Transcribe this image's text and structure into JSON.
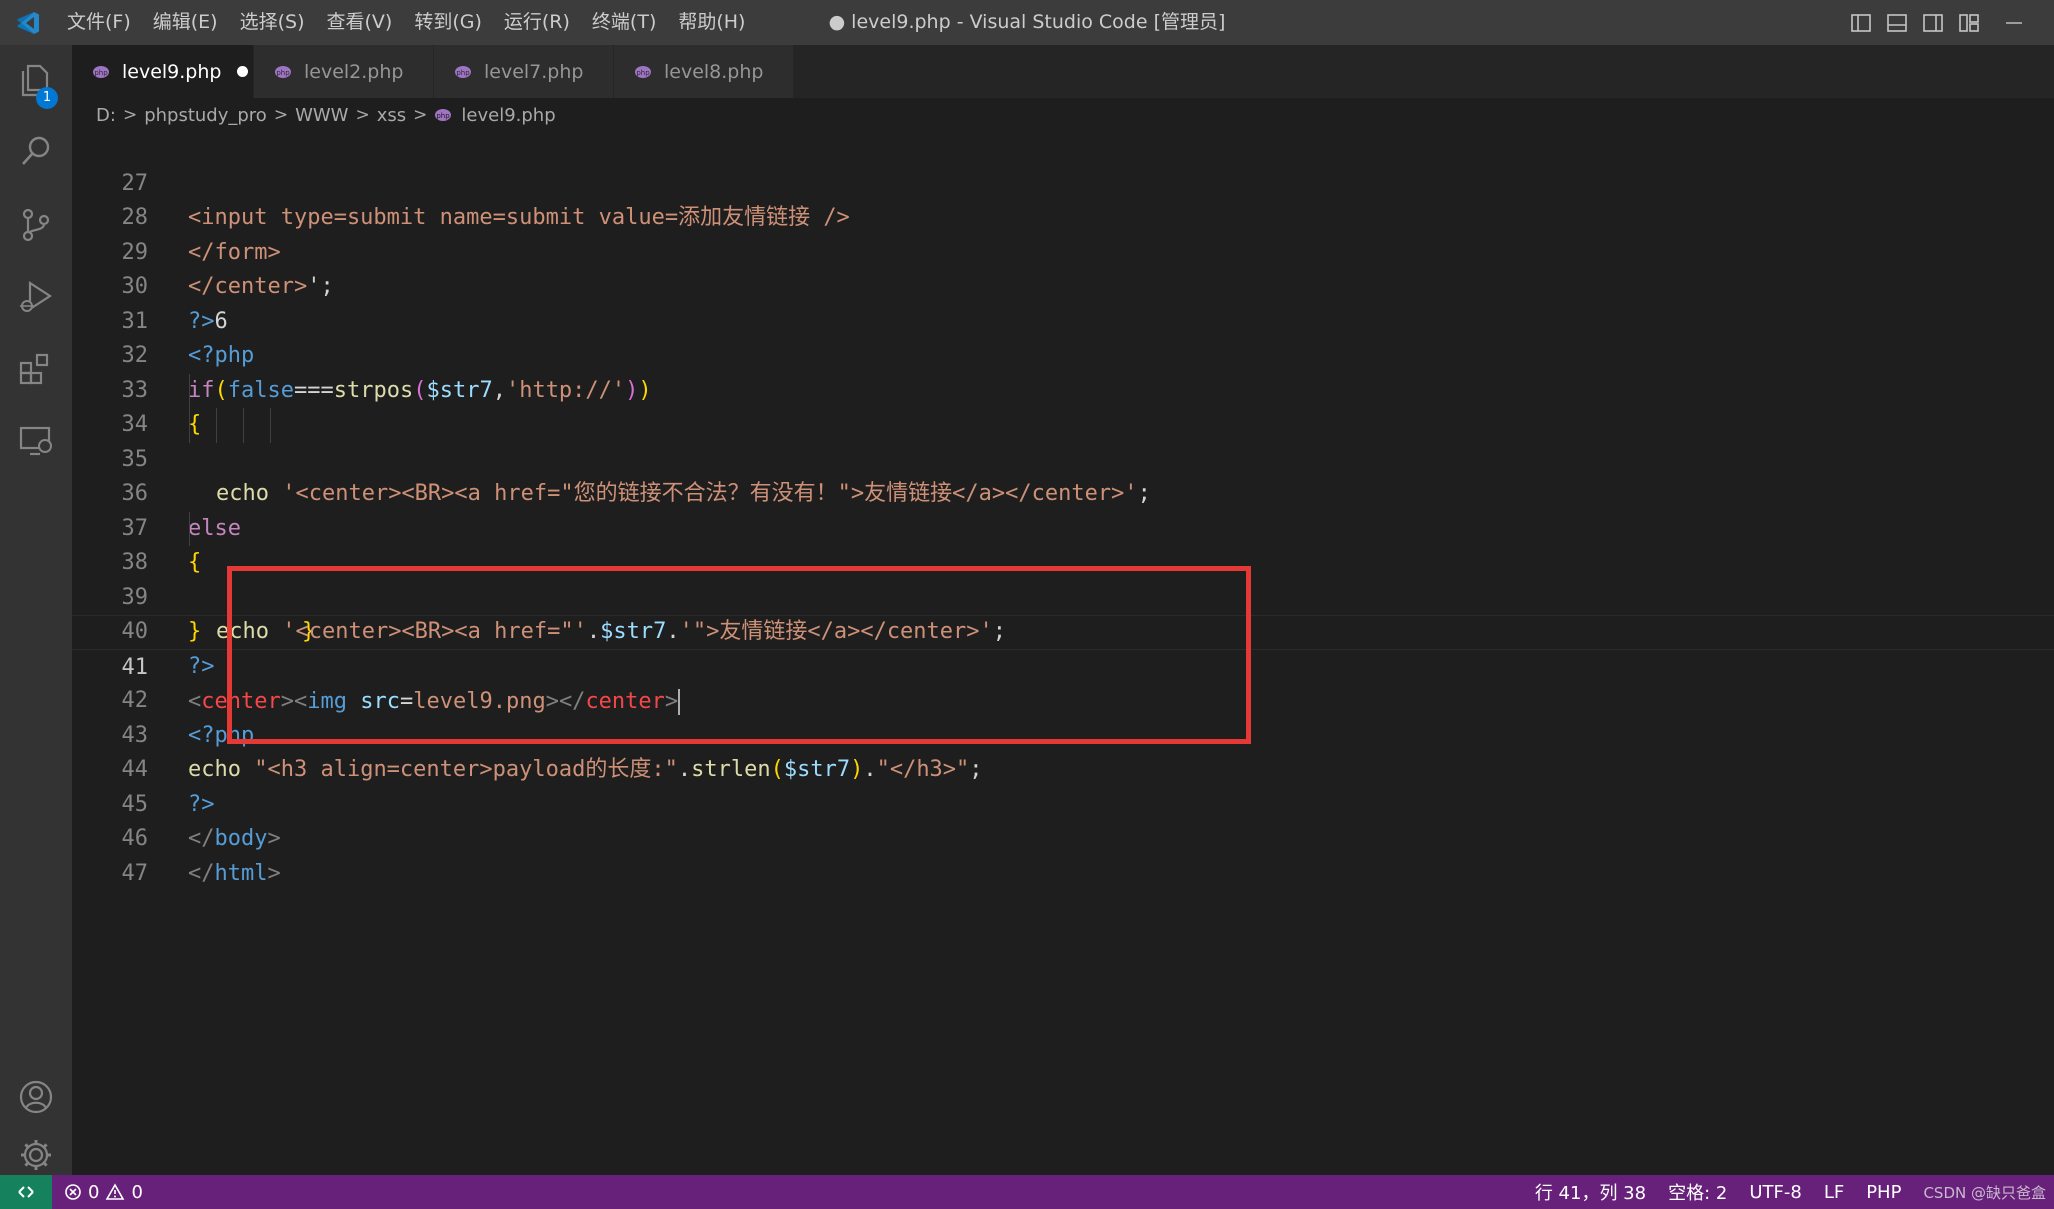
{
  "colors": {
    "titlebar": "#3c3c3c",
    "activitybar": "#333333",
    "editor_bg": "#1e1e1e",
    "statusbar": "#68217a",
    "remote_button": "#16825d",
    "badge": "#0078d4",
    "annotation_box": "#e53935"
  },
  "titlebar": {
    "menu": [
      "文件(F)",
      "编辑(E)",
      "选择(S)",
      "查看(V)",
      "转到(G)",
      "运行(R)",
      "终端(T)",
      "帮助(H)"
    ],
    "window_title": "● level9.php - Visual Studio Code [管理员]"
  },
  "activitybar": {
    "items": [
      "explorer-icon",
      "search-icon",
      "source-control-icon",
      "run-debug-icon",
      "extensions-icon",
      "remote-explorer-icon",
      "accounts-icon",
      "manage-gear-icon"
    ],
    "explorer_badge": "1"
  },
  "tabs": [
    {
      "label": "level9.php",
      "active": true,
      "unsaved": true
    },
    {
      "label": "level2.php",
      "active": false
    },
    {
      "label": "level7.php",
      "active": false
    },
    {
      "label": "level8.php",
      "active": false
    }
  ],
  "breadcrumb": [
    "D:",
    "phpstudy_pro",
    "WWW",
    "xss",
    "level9.php"
  ],
  "editor": {
    "current_line": 41,
    "line_numbers": [
      "27",
      "28",
      "29",
      "30",
      "31",
      "32",
      "33",
      "34",
      "35",
      "36",
      "37",
      "38",
      "39",
      "40",
      "41",
      "42",
      "43",
      "44",
      "45",
      "46",
      "47"
    ],
    "code_tokens": {
      "l27": [
        "<input type=submit name=submit value=添加友情链接 />"
      ],
      "l28": [
        "</form>"
      ],
      "l29": [
        "</center>",
        "';"
      ],
      "l30": [
        "?>",
        "6"
      ],
      "l31": [
        "<?php"
      ],
      "l32": [
        "if",
        "(",
        "false",
        "===",
        "strpos",
        "(",
        "$str7",
        ",",
        "'http://'",
        ")",
        ")"
      ],
      "l33": [
        "{"
      ],
      "l34": [
        "echo",
        " ",
        "'<center><BR><a href=\"您的链接不合法？有没有！\">友情链接</a></center>'",
        ";"
      ],
      "l35": [
        "}"
      ],
      "l36": [
        "else"
      ],
      "l37": [
        "{"
      ],
      "l38": [
        "echo",
        " ",
        "'<center><BR><a href=\"'",
        ".",
        "$str7",
        ".",
        "'\">友情链接</a></center>'",
        ";"
      ],
      "l39": [
        "}"
      ],
      "l40": [
        "?>"
      ],
      "l41": [
        "<",
        "center",
        ">",
        "<",
        "img",
        " ",
        "src",
        "=",
        "level9.png",
        ">",
        "</",
        "center",
        ">"
      ],
      "l42": [
        "<?php"
      ],
      "l43": [
        "echo",
        " ",
        "\"<h3 align=center>payload的长度:\"",
        ".",
        "strlen",
        "(",
        "$str7",
        ")",
        ".",
        "\"</h3>\"",
        ";"
      ],
      "l44": [
        "?>"
      ],
      "l45": [
        "</",
        "body",
        ">"
      ],
      "l46": [
        "</",
        "html",
        ">"
      ]
    }
  },
  "statusbar": {
    "errors": "0",
    "warnings": "0",
    "position": "行 41，列 38",
    "spaces": "空格: 2",
    "encoding": "UTF-8",
    "eol": "LF",
    "language": "PHP",
    "watermark": "CSDN @缺只爸盒"
  }
}
